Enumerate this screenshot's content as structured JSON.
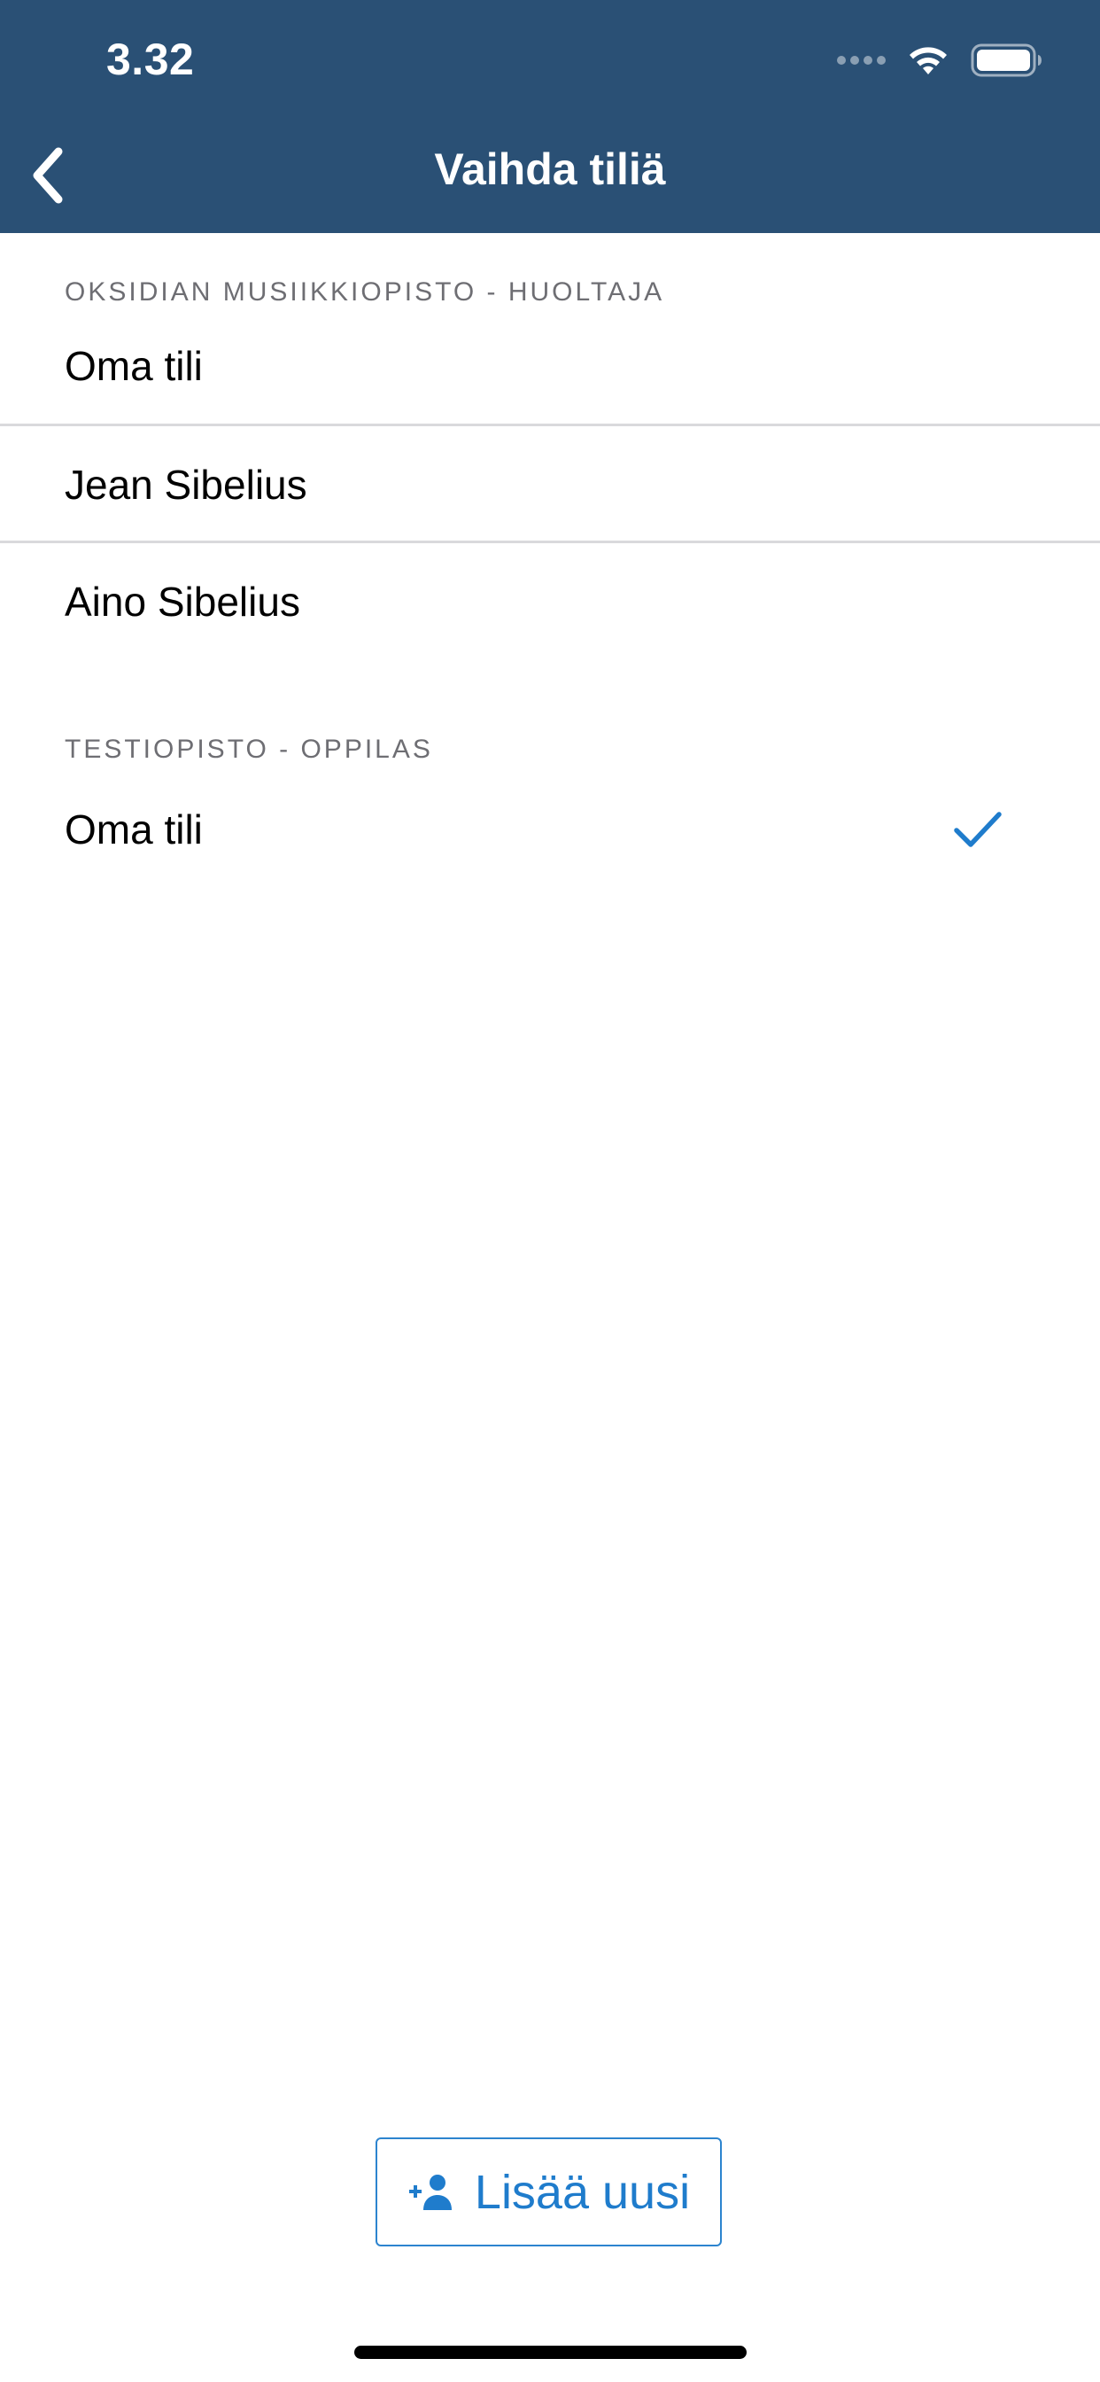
{
  "status_bar": {
    "time": "3.32",
    "icons": [
      "signal-dots-icon",
      "wifi-icon",
      "battery-icon"
    ]
  },
  "nav": {
    "title": "Vaihda tiliä",
    "back_icon": "chevron-left-icon"
  },
  "sections": [
    {
      "header": "OKSIDIAN MUSIIKKIOPISTO - HUOLTAJA",
      "rows": [
        {
          "label": "Oma tili",
          "selected": false
        },
        {
          "label": "Jean Sibelius",
          "selected": false
        },
        {
          "label": "Aino Sibelius",
          "selected": false
        }
      ]
    },
    {
      "header": "TESTIOPISTO - OPPILAS",
      "rows": [
        {
          "label": "Oma tili",
          "selected": true
        }
      ]
    }
  ],
  "add_button": {
    "label": "Lisää uusi",
    "icon": "add-person-icon"
  },
  "colors": {
    "header_bg": "#2a5075",
    "accent": "#1f7ccc",
    "section_header_text": "#6e6e73"
  }
}
